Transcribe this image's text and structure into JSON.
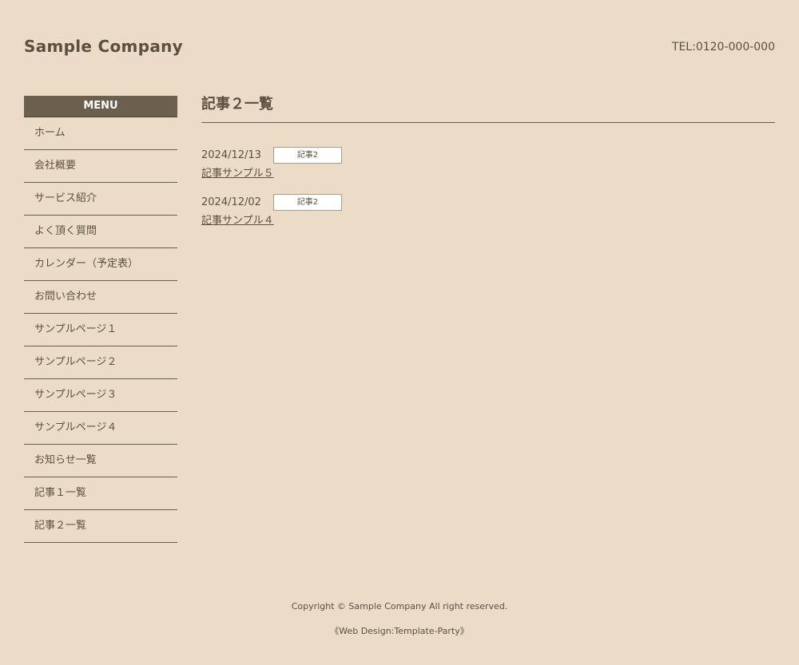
{
  "header": {
    "logo": "Sample Company",
    "tel": "TEL:0120-000-000"
  },
  "sidebar": {
    "title": "MENU",
    "items": [
      {
        "label": "ホーム"
      },
      {
        "label": "会社概要"
      },
      {
        "label": "サービス紹介"
      },
      {
        "label": "よく頂く質問"
      },
      {
        "label": "カレンダー（予定表）"
      },
      {
        "label": "お問い合わせ"
      },
      {
        "label": "サンプルページ１"
      },
      {
        "label": "サンプルページ２"
      },
      {
        "label": "サンプルページ３"
      },
      {
        "label": "サンプルページ４"
      },
      {
        "label": "お知らせ一覧"
      },
      {
        "label": "記事１一覧"
      },
      {
        "label": "記事２一覧"
      }
    ]
  },
  "main": {
    "title": "記事２一覧",
    "entries": [
      {
        "date": "2024/12/13",
        "badge": "記事2",
        "title": "記事サンプル５"
      },
      {
        "date": "2024/12/02",
        "badge": "記事2",
        "title": "記事サンプル４"
      }
    ]
  },
  "footer": {
    "copyright": "Copyright © Sample Company All right reserved.",
    "credit_open": "《",
    "credit_link": "Web Design:Template-Party",
    "credit_close": "》"
  }
}
